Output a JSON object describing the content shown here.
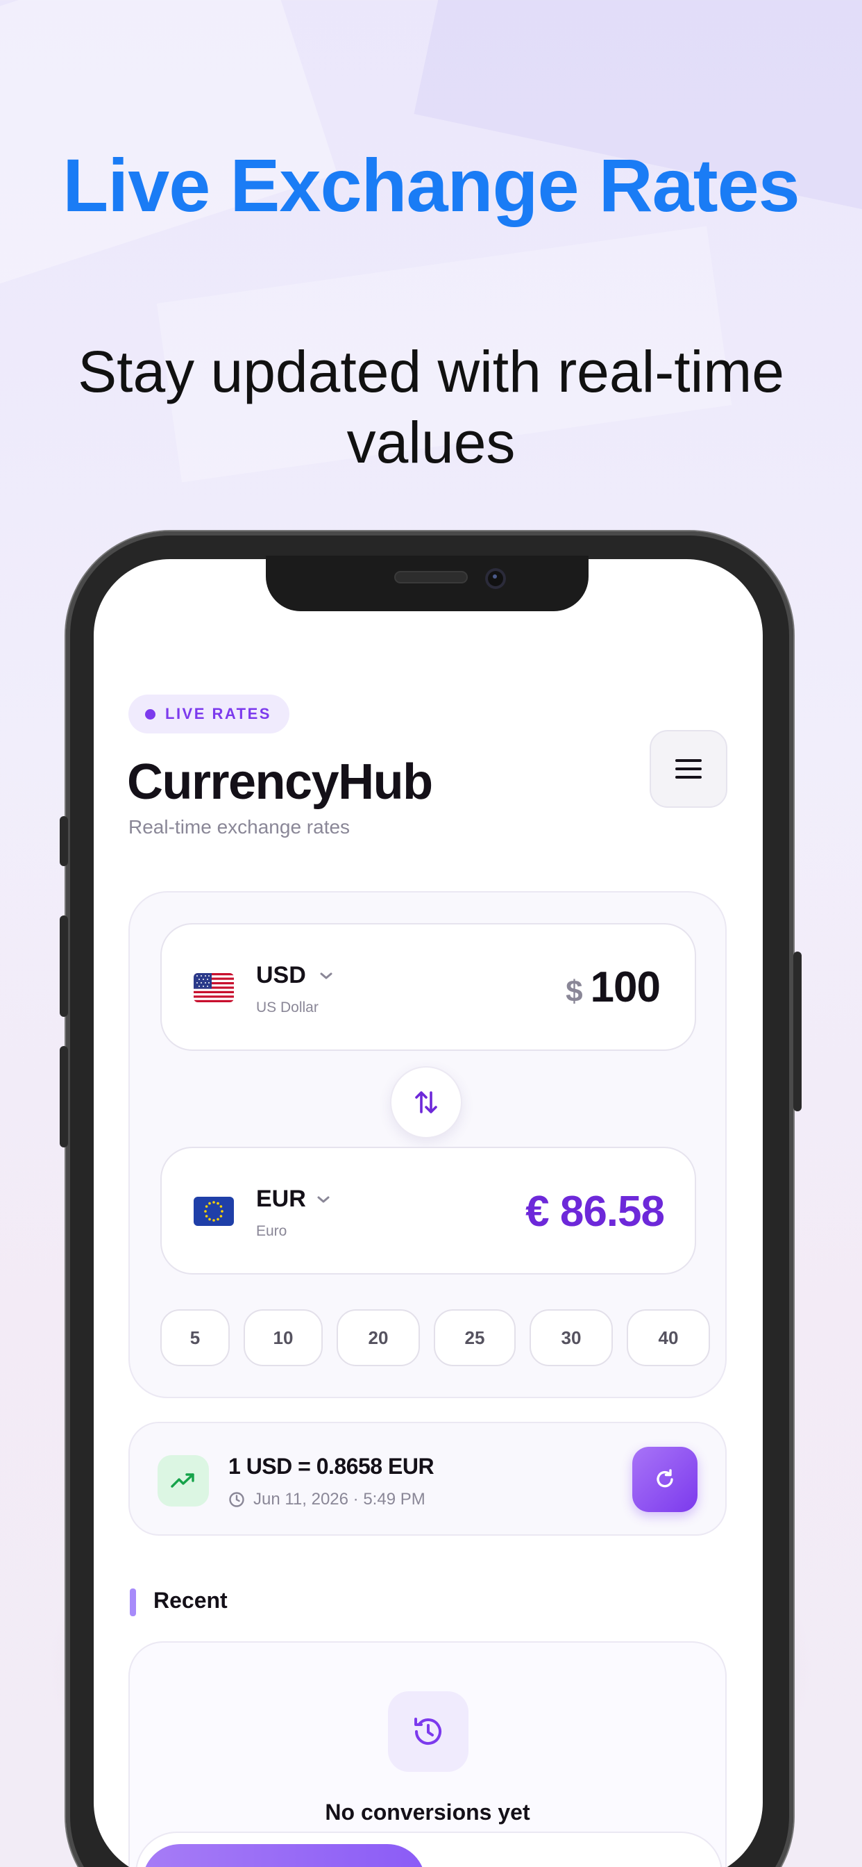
{
  "promo": {
    "headline": "Live Exchange Rates",
    "subheadline": "Stay updated with real-time values"
  },
  "app": {
    "badge": "LIVE RATES",
    "title": "CurrencyHub",
    "subtitle": "Real-time exchange rates",
    "menu_icon": "hamburger-menu-icon"
  },
  "converter": {
    "from": {
      "code": "USD",
      "name": "US Dollar",
      "symbol": "$",
      "amount": "100",
      "flag": "us-flag-icon"
    },
    "to": {
      "code": "EUR",
      "name": "Euro",
      "amount": "€ 86.58",
      "flag": "eu-flag-icon"
    },
    "swap_icon": "swap-arrows-icon",
    "quick_amounts": [
      "5",
      "10",
      "20",
      "25",
      "30",
      "40"
    ]
  },
  "rate": {
    "text": "1 USD = 0.8658 EUR",
    "timestamp": "Jun 11, 2026 · 5:49 PM",
    "trend_icon": "trending-up-icon",
    "refresh_icon": "refresh-icon"
  },
  "recent": {
    "label": "Recent",
    "empty_text": "No conversions yet",
    "empty_icon": "history-icon"
  },
  "colors": {
    "headline": "#1a7cf5",
    "accent": "#7c3aed",
    "converted_amount": "#6d28d9",
    "trend": "#16a34a"
  }
}
